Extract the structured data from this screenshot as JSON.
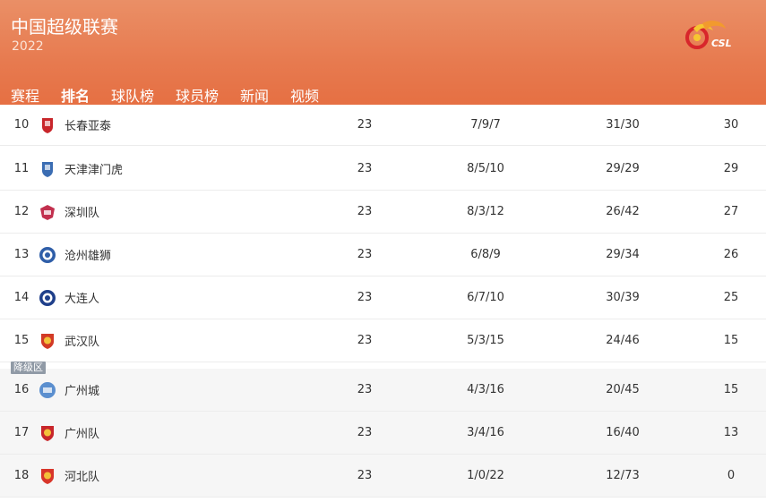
{
  "header": {
    "league_title": "中国超级联赛",
    "season": "2022",
    "logo_text": "CSL"
  },
  "nav": {
    "items": [
      {
        "label": "赛程"
      },
      {
        "label": "排名",
        "active": true
      },
      {
        "label": "球队榜"
      },
      {
        "label": "球员榜"
      },
      {
        "label": "新闻"
      },
      {
        "label": "视频"
      }
    ]
  },
  "relegation_zone_label": "降级区",
  "standings": [
    {
      "rank": "10",
      "team": "长春亚泰",
      "played": "23",
      "wdl": "7/9/7",
      "goals": "31/30",
      "points": "30",
      "badge": "shield-red",
      "badge_color": "#c8262b"
    },
    {
      "rank": "11",
      "team": "天津津门虎",
      "played": "23",
      "wdl": "8/5/10",
      "goals": "29/29",
      "points": "29",
      "badge": "shield-blue",
      "badge_color": "#3b6db3"
    },
    {
      "rank": "12",
      "team": "深圳队",
      "played": "23",
      "wdl": "8/3/12",
      "goals": "26/42",
      "points": "27",
      "badge": "crest-pink",
      "badge_color": "#c2304e"
    },
    {
      "rank": "13",
      "team": "沧州雄狮",
      "played": "23",
      "wdl": "6/8/9",
      "goals": "29/34",
      "points": "26",
      "badge": "circle-blue",
      "badge_color": "#2f5ea8"
    },
    {
      "rank": "14",
      "team": "大连人",
      "played": "23",
      "wdl": "6/7/10",
      "goals": "30/39",
      "points": "25",
      "badge": "circle-navy",
      "badge_color": "#1f3f8a"
    },
    {
      "rank": "15",
      "team": "武汉队",
      "played": "23",
      "wdl": "5/3/15",
      "goals": "24/46",
      "points": "15",
      "badge": "crest-red-gold",
      "badge_color": "#d23a26"
    },
    {
      "rank": "16",
      "team": "广州城",
      "played": "23",
      "wdl": "4/3/16",
      "goals": "20/45",
      "points": "15",
      "badge": "crest-lightblue",
      "badge_color": "#5b8fcf",
      "relegation": true
    },
    {
      "rank": "17",
      "team": "广州队",
      "played": "23",
      "wdl": "3/4/16",
      "goals": "16/40",
      "points": "13",
      "badge": "crest-red-gold",
      "badge_color": "#c8262b",
      "relegation": true
    },
    {
      "rank": "18",
      "team": "河北队",
      "played": "23",
      "wdl": "1/0/22",
      "goals": "12/73",
      "points": "0",
      "badge": "crest-red-gold",
      "badge_color": "#d8362a",
      "relegation": true
    }
  ],
  "colors": {
    "header_accent": "#e77a4f",
    "relegation_tag": "#909aa6"
  }
}
